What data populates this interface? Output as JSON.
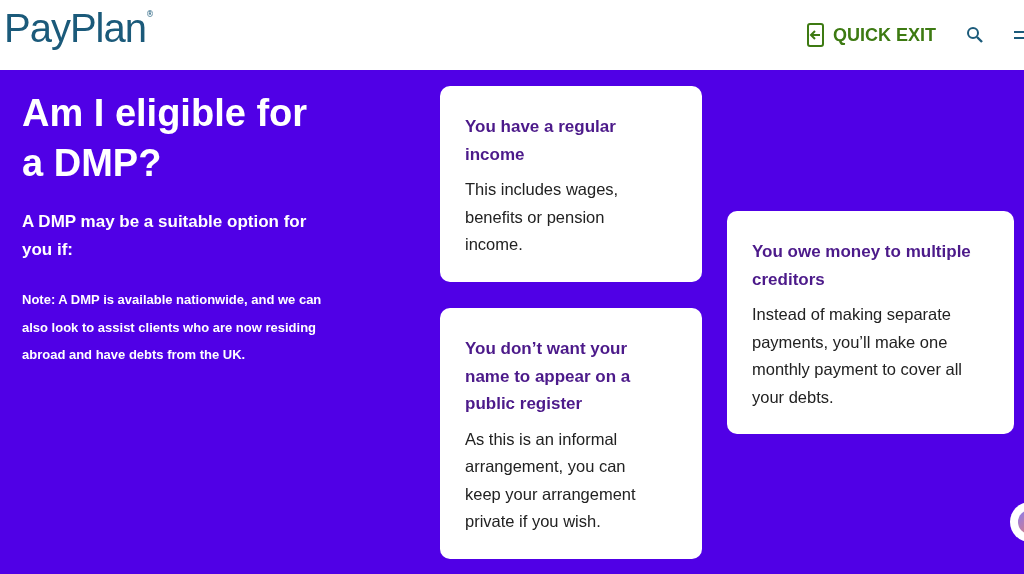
{
  "header": {
    "logo": "PayPlan",
    "logo_mark": "®",
    "quick_exit": "QUICK EXIT"
  },
  "hero": {
    "title": "Am I eligible for a DMP?",
    "subtitle": "A DMP may be a suitable option for you if:",
    "note": "Note: A DMP is available nationwide, and we can also look to assist clients who are now residing abroad and have debts from the UK."
  },
  "card_columns": [
    {
      "cards": [
        {
          "title": "You have a regular income",
          "body": "This includes wages, benefits or pension income."
        },
        {
          "title": "You don’t want your name to appear on a public register",
          "body": "As this is an informal arrangement, you can keep your arrangement private if you wish."
        }
      ]
    },
    {
      "cards": [
        {
          "title": "You owe money to multiple creditors",
          "body": "Instead of making separate payments, you’ll make one monthly payment to cover all your debts."
        }
      ]
    }
  ]
}
